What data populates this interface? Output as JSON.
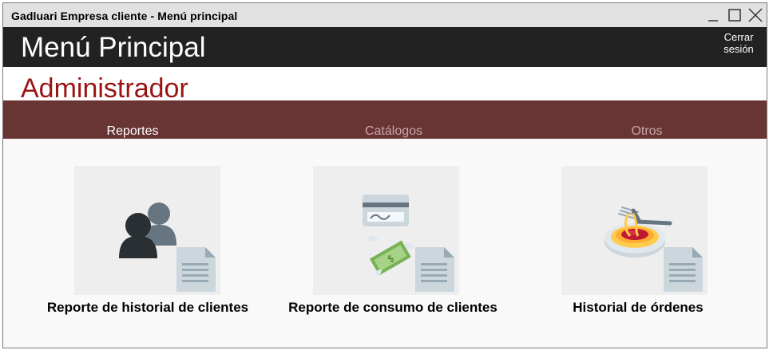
{
  "window": {
    "title": "Gadluari Empresa cliente - Menú principal"
  },
  "header": {
    "title": "Menú Principal",
    "logout_line1": "Cerrar",
    "logout_line2": "sesión"
  },
  "role": {
    "label": "Administrador"
  },
  "tabs": [
    {
      "label": "Reportes",
      "active": true
    },
    {
      "label": "Catálogos",
      "active": false
    },
    {
      "label": "Otros",
      "active": false
    }
  ],
  "cards": [
    {
      "label": "Reporte de historial de clientes",
      "icon": "users-report-icon"
    },
    {
      "label": "Reporte de consumo de clientes",
      "icon": "consumption-report-icon"
    },
    {
      "label": "Historial de órdenes",
      "icon": "orders-history-icon"
    }
  ],
  "colors": {
    "header_bg": "#222222",
    "tab_bar_bg": "#693434",
    "role_text": "#9b1414"
  }
}
